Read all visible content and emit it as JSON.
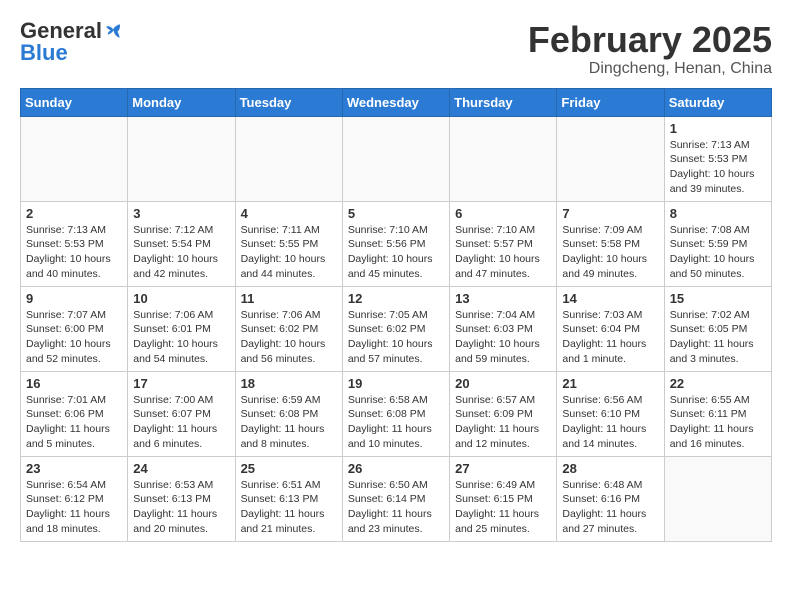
{
  "header": {
    "logo": {
      "general": "General",
      "blue": "Blue"
    },
    "month": "February 2025",
    "location": "Dingcheng, Henan, China"
  },
  "weekdays": [
    "Sunday",
    "Monday",
    "Tuesday",
    "Wednesday",
    "Thursday",
    "Friday",
    "Saturday"
  ],
  "weeks": [
    [
      {
        "day": "",
        "info": ""
      },
      {
        "day": "",
        "info": ""
      },
      {
        "day": "",
        "info": ""
      },
      {
        "day": "",
        "info": ""
      },
      {
        "day": "",
        "info": ""
      },
      {
        "day": "",
        "info": ""
      },
      {
        "day": "1",
        "info": "Sunrise: 7:13 AM\nSunset: 5:53 PM\nDaylight: 10 hours\nand 39 minutes."
      }
    ],
    [
      {
        "day": "2",
        "info": "Sunrise: 7:13 AM\nSunset: 5:53 PM\nDaylight: 10 hours\nand 40 minutes."
      },
      {
        "day": "3",
        "info": "Sunrise: 7:12 AM\nSunset: 5:54 PM\nDaylight: 10 hours\nand 42 minutes."
      },
      {
        "day": "4",
        "info": "Sunrise: 7:11 AM\nSunset: 5:55 PM\nDaylight: 10 hours\nand 44 minutes."
      },
      {
        "day": "5",
        "info": "Sunrise: 7:10 AM\nSunset: 5:56 PM\nDaylight: 10 hours\nand 45 minutes."
      },
      {
        "day": "6",
        "info": "Sunrise: 7:10 AM\nSunset: 5:57 PM\nDaylight: 10 hours\nand 47 minutes."
      },
      {
        "day": "7",
        "info": "Sunrise: 7:09 AM\nSunset: 5:58 PM\nDaylight: 10 hours\nand 49 minutes."
      },
      {
        "day": "8",
        "info": "Sunrise: 7:08 AM\nSunset: 5:59 PM\nDaylight: 10 hours\nand 50 minutes."
      }
    ],
    [
      {
        "day": "9",
        "info": "Sunrise: 7:07 AM\nSunset: 6:00 PM\nDaylight: 10 hours\nand 52 minutes."
      },
      {
        "day": "10",
        "info": "Sunrise: 7:06 AM\nSunset: 6:01 PM\nDaylight: 10 hours\nand 54 minutes."
      },
      {
        "day": "11",
        "info": "Sunrise: 7:06 AM\nSunset: 6:02 PM\nDaylight: 10 hours\nand 56 minutes."
      },
      {
        "day": "12",
        "info": "Sunrise: 7:05 AM\nSunset: 6:02 PM\nDaylight: 10 hours\nand 57 minutes."
      },
      {
        "day": "13",
        "info": "Sunrise: 7:04 AM\nSunset: 6:03 PM\nDaylight: 10 hours\nand 59 minutes."
      },
      {
        "day": "14",
        "info": "Sunrise: 7:03 AM\nSunset: 6:04 PM\nDaylight: 11 hours\nand 1 minute."
      },
      {
        "day": "15",
        "info": "Sunrise: 7:02 AM\nSunset: 6:05 PM\nDaylight: 11 hours\nand 3 minutes."
      }
    ],
    [
      {
        "day": "16",
        "info": "Sunrise: 7:01 AM\nSunset: 6:06 PM\nDaylight: 11 hours\nand 5 minutes."
      },
      {
        "day": "17",
        "info": "Sunrise: 7:00 AM\nSunset: 6:07 PM\nDaylight: 11 hours\nand 6 minutes."
      },
      {
        "day": "18",
        "info": "Sunrise: 6:59 AM\nSunset: 6:08 PM\nDaylight: 11 hours\nand 8 minutes."
      },
      {
        "day": "19",
        "info": "Sunrise: 6:58 AM\nSunset: 6:08 PM\nDaylight: 11 hours\nand 10 minutes."
      },
      {
        "day": "20",
        "info": "Sunrise: 6:57 AM\nSunset: 6:09 PM\nDaylight: 11 hours\nand 12 minutes."
      },
      {
        "day": "21",
        "info": "Sunrise: 6:56 AM\nSunset: 6:10 PM\nDaylight: 11 hours\nand 14 minutes."
      },
      {
        "day": "22",
        "info": "Sunrise: 6:55 AM\nSunset: 6:11 PM\nDaylight: 11 hours\nand 16 minutes."
      }
    ],
    [
      {
        "day": "23",
        "info": "Sunrise: 6:54 AM\nSunset: 6:12 PM\nDaylight: 11 hours\nand 18 minutes."
      },
      {
        "day": "24",
        "info": "Sunrise: 6:53 AM\nSunset: 6:13 PM\nDaylight: 11 hours\nand 20 minutes."
      },
      {
        "day": "25",
        "info": "Sunrise: 6:51 AM\nSunset: 6:13 PM\nDaylight: 11 hours\nand 21 minutes."
      },
      {
        "day": "26",
        "info": "Sunrise: 6:50 AM\nSunset: 6:14 PM\nDaylight: 11 hours\nand 23 minutes."
      },
      {
        "day": "27",
        "info": "Sunrise: 6:49 AM\nSunset: 6:15 PM\nDaylight: 11 hours\nand 25 minutes."
      },
      {
        "day": "28",
        "info": "Sunrise: 6:48 AM\nSunset: 6:16 PM\nDaylight: 11 hours\nand 27 minutes."
      },
      {
        "day": "",
        "info": ""
      }
    ]
  ]
}
